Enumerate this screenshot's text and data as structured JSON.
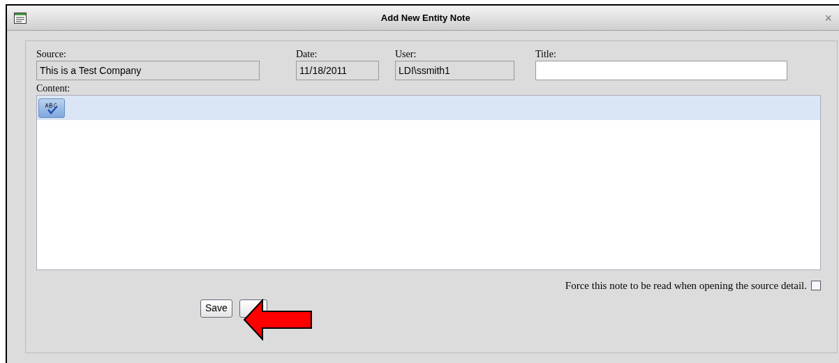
{
  "window": {
    "title": "Add New Entity Note",
    "close": "×"
  },
  "fields": [
    {
      "label": "Source:",
      "value": "This is a Test Company",
      "kind": "readonly"
    },
    {
      "label": "Date:",
      "value": "11/18/2011",
      "kind": "readonly"
    },
    {
      "label": "User:",
      "value": "LDI\\ssmith1",
      "kind": "readonly"
    },
    {
      "label": "Title:",
      "kind": "editable"
    }
  ],
  "content": {
    "label": "Content:"
  },
  "force_read": {
    "label": "Force this note to be read when opening the source detail.",
    "checked": false
  },
  "buttons": [
    {
      "kind": "labeled",
      "label": "Save"
    },
    {
      "kind": "covered"
    }
  ]
}
